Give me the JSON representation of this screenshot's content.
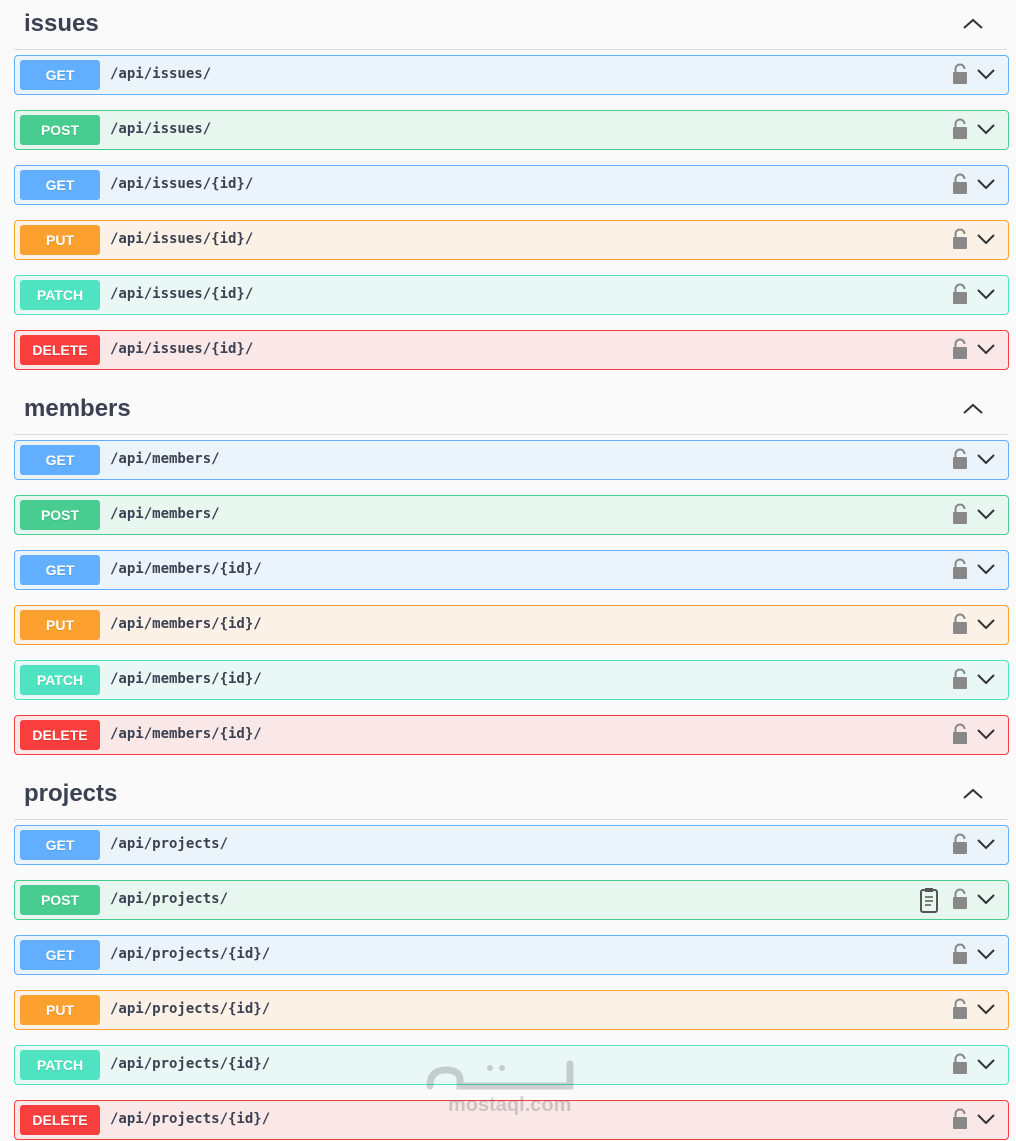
{
  "sections": [
    {
      "title": "issues",
      "operations": [
        {
          "method": "GET",
          "path": "/api/issues/"
        },
        {
          "method": "POST",
          "path": "/api/issues/"
        },
        {
          "method": "GET",
          "path": "/api/issues/{id}/"
        },
        {
          "method": "PUT",
          "path": "/api/issues/{id}/"
        },
        {
          "method": "PATCH",
          "path": "/api/issues/{id}/"
        },
        {
          "method": "DELETE",
          "path": "/api/issues/{id}/"
        }
      ]
    },
    {
      "title": "members",
      "operations": [
        {
          "method": "GET",
          "path": "/api/members/"
        },
        {
          "method": "POST",
          "path": "/api/members/"
        },
        {
          "method": "GET",
          "path": "/api/members/{id}/"
        },
        {
          "method": "PUT",
          "path": "/api/members/{id}/"
        },
        {
          "method": "PATCH",
          "path": "/api/members/{id}/"
        },
        {
          "method": "DELETE",
          "path": "/api/members/{id}/"
        }
      ]
    },
    {
      "title": "projects",
      "operations": [
        {
          "method": "GET",
          "path": "/api/projects/"
        },
        {
          "method": "POST",
          "path": "/api/projects/",
          "extra_icon": "clipboard-icon"
        },
        {
          "method": "GET",
          "path": "/api/projects/{id}/"
        },
        {
          "method": "PUT",
          "path": "/api/projects/{id}/"
        },
        {
          "method": "PATCH",
          "path": "/api/projects/{id}/"
        },
        {
          "method": "DELETE",
          "path": "/api/projects/{id}/"
        }
      ]
    }
  ],
  "colors": {
    "GET": "#61affe",
    "POST": "#49cc90",
    "PUT": "#fca130",
    "PATCH": "#50e3c2",
    "DELETE": "#f93e3e"
  },
  "icons": {
    "collapse": "chevron-up-icon",
    "lock": "lock-icon",
    "expand": "chevron-down-icon"
  },
  "watermark": {
    "text": "mostaql.com"
  }
}
